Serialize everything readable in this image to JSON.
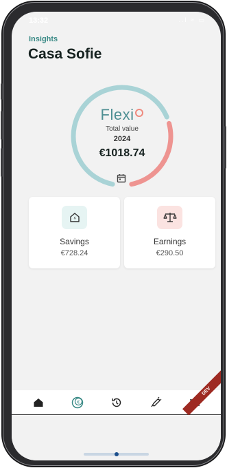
{
  "status": {
    "time": "13:32",
    "icons": "..l ≈ ▭"
  },
  "header": {
    "section": "Insights",
    "title": "Casa Sofie"
  },
  "gauge": {
    "brand": "Flexi",
    "label": "Total value",
    "year": "2024",
    "amount": "€1018.74",
    "savings_fraction": 0.7148,
    "earnings_fraction": 0.2852,
    "colors": {
      "savings": "#a9d3d6",
      "earnings": "#ee9491"
    }
  },
  "cards": [
    {
      "label": "Savings",
      "value": "€728.24",
      "icon": "house-bolt-icon",
      "accent": "#e6f4f3"
    },
    {
      "label": "Earnings",
      "value": "€290.50",
      "icon": "scales-icon",
      "accent": "#fbe3e1"
    }
  ],
  "nav": {
    "items": [
      "home-icon",
      "euro-coin-icon",
      "history-icon",
      "plug-icon",
      "menu-icon"
    ],
    "dev_badge": "DEV"
  }
}
